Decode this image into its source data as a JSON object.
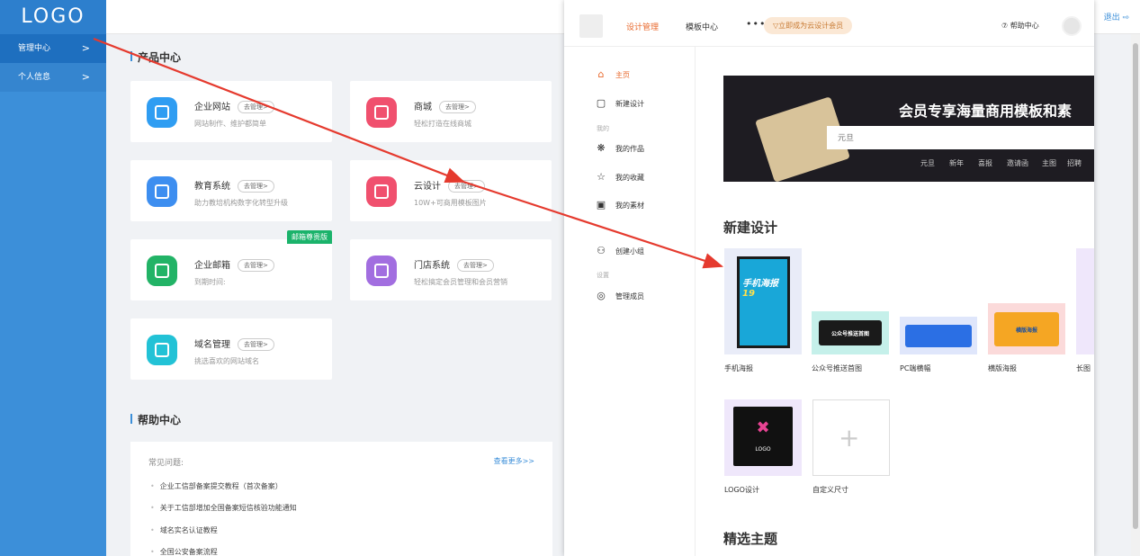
{
  "logo": "LOGO",
  "sidebar": {
    "items": [
      {
        "label": "管理中心",
        "chevron": ">"
      },
      {
        "label": "个人信息",
        "chevron": ">"
      }
    ]
  },
  "header": {
    "logout": "退出 ⇨"
  },
  "product_center": {
    "title": "产品中心",
    "cards": [
      {
        "title": "企业网站",
        "tag": "去管理>",
        "desc": "网站制作、维护都简单",
        "icon": "website-icon",
        "color": "#2f9df2"
      },
      {
        "title": "商城",
        "tag": "去管理>",
        "desc": "轻松打造在线商城",
        "icon": "shop-icon",
        "color": "#f0506e"
      },
      {
        "title": "教育系统",
        "tag": "去管理>",
        "desc": "助力教培机构数字化转型升级",
        "icon": "education-icon",
        "color": "#3d8ef0"
      },
      {
        "title": "云设计",
        "tag": "去管理>",
        "desc": "10W+可商用模板图片",
        "icon": "cloud-design-icon",
        "color": "#f0506e"
      },
      {
        "title": "企业邮箱",
        "tag": "去管理>",
        "desc": "到期时间:",
        "icon": "mail-icon",
        "color": "#22b366",
        "badge": "邮箱尊贵版"
      },
      {
        "title": "门店系统",
        "tag": "去管理>",
        "desc": "轻松搞定会员管理和会员营销",
        "icon": "store-icon",
        "color": "#a26ee0"
      },
      {
        "title": "域名管理",
        "tag": "去管理>",
        "desc": "挑选喜欢的网站域名",
        "icon": "domain-icon",
        "color": "#22c2d6"
      }
    ]
  },
  "help_center": {
    "title": "帮助中心",
    "faq_label": "常见问题:",
    "more": "查看更多>>",
    "items": [
      "企业工信部备案提交教程（首次备案）",
      "关于工信部增加全国备案短信核验功能通知",
      "域名实名认证教程",
      "全国公安备案流程"
    ]
  },
  "design_window": {
    "tabs": [
      "设计管理",
      "模板中心"
    ],
    "more": "•••",
    "vip": "▽立即成为云设计会员",
    "help": "⑦ 帮助中心",
    "side": {
      "home": "主页",
      "new_design": "新建设计",
      "group_mine": "我的",
      "works": "我的作品",
      "favorites": "我的收藏",
      "materials": "我的素材",
      "create_group": "创建小组",
      "group_settings": "设置",
      "members": "管理成员"
    },
    "banner": {
      "headline": "会员专享海量商用模板和素",
      "search_placeholder": "元旦",
      "keywords": [
        "元旦",
        "新年",
        "喜报",
        "邀请函",
        "主图",
        "招聘"
      ]
    },
    "new_design_title": "新建设计",
    "templates": [
      {
        "label": "手机海报",
        "poster_text": "手机海报",
        "poster_num": "19"
      },
      {
        "label": "公众号推送首图",
        "mini_text": "公众号推送首图"
      },
      {
        "label": "PC端横幅"
      },
      {
        "label": "横版海报",
        "mini_text": "横版海报"
      },
      {
        "label": "长图"
      },
      {
        "label": "LOGO设计",
        "mini_text": "LOGO"
      },
      {
        "label": "自定义尺寸"
      }
    ],
    "featured_title": "精选主题"
  },
  "colors": {
    "sidebar": "#3c8fd9",
    "accent": "#e8682c",
    "arrow": "#e53a2e"
  }
}
